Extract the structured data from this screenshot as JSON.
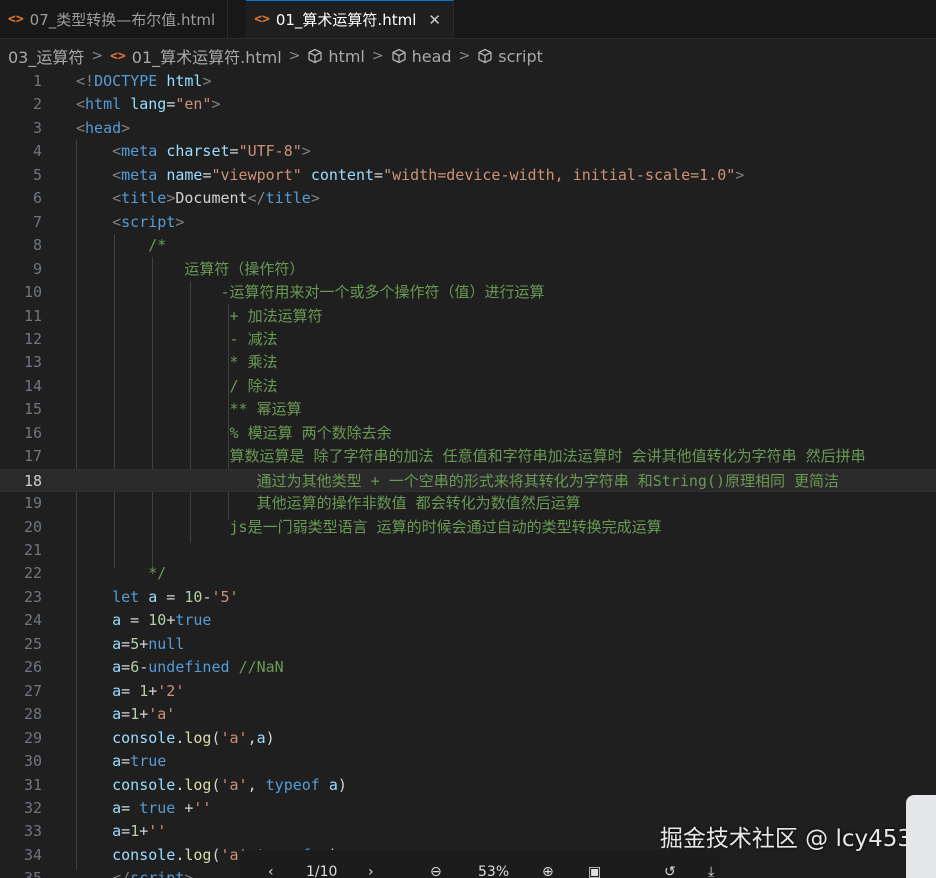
{
  "tabs": [
    {
      "icon": "html-file-icon",
      "glyph": "<>",
      "label": "07_类型转换—布尔值.html",
      "active": false
    },
    {
      "icon": "html-file-icon",
      "glyph": "<>",
      "label": "01_算术运算符.html",
      "active": true,
      "close": "✕"
    }
  ],
  "breadcrumb": {
    "separator": ">",
    "items": [
      "03_运算符",
      "01_算术运算符.html",
      "html",
      "head",
      "script"
    ]
  },
  "editor": {
    "current_line": 18,
    "lines": [
      {
        "n": "1",
        "tokens": [
          [
            "t-punct",
            "<!"
          ],
          [
            "t-html-kw",
            "DOCTYPE "
          ],
          [
            "t-attr",
            "html"
          ],
          [
            "t-punct",
            ">"
          ]
        ]
      },
      {
        "n": "2",
        "tokens": [
          [
            "t-punct",
            "<"
          ],
          [
            "t-tag",
            "html "
          ],
          [
            "t-attr",
            "lang"
          ],
          [
            "t-text",
            "="
          ],
          [
            "t-str",
            "\"en\""
          ],
          [
            "t-punct",
            ">"
          ]
        ]
      },
      {
        "n": "3",
        "tokens": [
          [
            "t-punct",
            "<"
          ],
          [
            "t-tag",
            "head"
          ],
          [
            "t-punct",
            ">"
          ]
        ]
      },
      {
        "n": "4",
        "tokens": [
          [
            "t-text",
            "    "
          ],
          [
            "t-punct",
            "<"
          ],
          [
            "t-tag",
            "meta "
          ],
          [
            "t-attr",
            "charset"
          ],
          [
            "t-text",
            "="
          ],
          [
            "t-str",
            "\"UTF-8\""
          ],
          [
            "t-punct",
            ">"
          ]
        ]
      },
      {
        "n": "5",
        "tokens": [
          [
            "t-text",
            "    "
          ],
          [
            "t-punct",
            "<"
          ],
          [
            "t-tag",
            "meta "
          ],
          [
            "t-attr",
            "name"
          ],
          [
            "t-text",
            "="
          ],
          [
            "t-str",
            "\"viewport\" "
          ],
          [
            "t-attr",
            "content"
          ],
          [
            "t-text",
            "="
          ],
          [
            "t-str",
            "\"width=device-width, initial-scale=1.0\""
          ],
          [
            "t-punct",
            ">"
          ]
        ]
      },
      {
        "n": "6",
        "tokens": [
          [
            "t-text",
            "    "
          ],
          [
            "t-punct",
            "<"
          ],
          [
            "t-tag",
            "title"
          ],
          [
            "t-punct",
            ">"
          ],
          [
            "t-text",
            "Document"
          ],
          [
            "t-punct",
            "</"
          ],
          [
            "t-tag",
            "title"
          ],
          [
            "t-punct",
            ">"
          ]
        ]
      },
      {
        "n": "7",
        "tokens": [
          [
            "t-text",
            "    "
          ],
          [
            "t-punct",
            "<"
          ],
          [
            "t-tag",
            "script"
          ],
          [
            "t-punct",
            ">"
          ]
        ]
      },
      {
        "n": "8",
        "tokens": [
          [
            "t-cmt",
            "        /*"
          ]
        ]
      },
      {
        "n": "9",
        "tokens": [
          [
            "t-cmt",
            "            运算符（操作符）"
          ]
        ]
      },
      {
        "n": "10",
        "tokens": [
          [
            "t-cmt",
            "                -运算符用来对一个或多个操作符（值）进行运算"
          ]
        ]
      },
      {
        "n": "11",
        "tokens": [
          [
            "t-cmt",
            "                 + 加法运算符"
          ]
        ]
      },
      {
        "n": "12",
        "tokens": [
          [
            "t-cmt",
            "                 - 减法"
          ]
        ]
      },
      {
        "n": "13",
        "tokens": [
          [
            "t-cmt",
            "                 * 乘法"
          ]
        ]
      },
      {
        "n": "14",
        "tokens": [
          [
            "t-cmt",
            "                 / 除法"
          ]
        ]
      },
      {
        "n": "15",
        "tokens": [
          [
            "t-cmt",
            "                 ** 幂运算"
          ]
        ]
      },
      {
        "n": "16",
        "tokens": [
          [
            "t-cmt",
            "                 % 模运算 两个数除去余"
          ]
        ]
      },
      {
        "n": "17",
        "tokens": [
          [
            "t-cmt",
            "                 算数运算是 除了字符串的加法 任意值和字符串加法运算时 会讲其他值转化为字符串 然后拼串"
          ]
        ]
      },
      {
        "n": "18",
        "tokens": [
          [
            "t-cmt",
            "                    通过为其他类型 + 一个空串的形式来将其转化为字符串 和String()原理相同 更简洁"
          ]
        ]
      },
      {
        "n": "19",
        "tokens": [
          [
            "t-cmt",
            "                    其他运算的操作非数值 都会转化为数值然后运算"
          ]
        ]
      },
      {
        "n": "20",
        "tokens": [
          [
            "t-cmt",
            "                 js是一门弱类型语言 运算的时候会通过自动的类型转换完成运算"
          ]
        ]
      },
      {
        "n": "21",
        "tokens": []
      },
      {
        "n": "22",
        "tokens": [
          [
            "t-cmt",
            "        */"
          ]
        ]
      },
      {
        "n": "23",
        "tokens": [
          [
            "t-text",
            "    "
          ],
          [
            "t-kw",
            "let "
          ],
          [
            "t-attr",
            "a"
          ],
          [
            "t-text",
            " = "
          ],
          [
            "t-num",
            "10"
          ],
          [
            "t-text",
            "-"
          ],
          [
            "t-str",
            "'5'"
          ]
        ]
      },
      {
        "n": "24",
        "tokens": [
          [
            "t-text",
            "    "
          ],
          [
            "t-attr",
            "a"
          ],
          [
            "t-text",
            " = "
          ],
          [
            "t-num",
            "10"
          ],
          [
            "t-text",
            "+"
          ],
          [
            "t-kw",
            "true"
          ]
        ]
      },
      {
        "n": "25",
        "tokens": [
          [
            "t-text",
            "    "
          ],
          [
            "t-attr",
            "a"
          ],
          [
            "t-text",
            "="
          ],
          [
            "t-num",
            "5"
          ],
          [
            "t-text",
            "+"
          ],
          [
            "t-kw",
            "null"
          ]
        ]
      },
      {
        "n": "26",
        "tokens": [
          [
            "t-text",
            "    "
          ],
          [
            "t-attr",
            "a"
          ],
          [
            "t-text",
            "="
          ],
          [
            "t-num",
            "6"
          ],
          [
            "t-text",
            "-"
          ],
          [
            "t-kw",
            "undefined "
          ],
          [
            "t-cmt",
            "//NaN"
          ]
        ]
      },
      {
        "n": "27",
        "tokens": [
          [
            "t-text",
            "    "
          ],
          [
            "t-attr",
            "a"
          ],
          [
            "t-text",
            "= "
          ],
          [
            "t-num",
            "1"
          ],
          [
            "t-text",
            "+"
          ],
          [
            "t-str",
            "'2'"
          ]
        ]
      },
      {
        "n": "28",
        "tokens": [
          [
            "t-text",
            "    "
          ],
          [
            "t-attr",
            "a"
          ],
          [
            "t-text",
            "="
          ],
          [
            "t-num",
            "1"
          ],
          [
            "t-text",
            "+"
          ],
          [
            "t-str",
            "'a'"
          ]
        ]
      },
      {
        "n": "29",
        "tokens": [
          [
            "t-text",
            "    "
          ],
          [
            "t-attr",
            "console"
          ],
          [
            "t-text",
            "."
          ],
          [
            "t-fn",
            "log"
          ],
          [
            "t-text",
            "("
          ],
          [
            "t-str",
            "'a'"
          ],
          [
            "t-text",
            ","
          ],
          [
            "t-attr",
            "a"
          ],
          [
            "t-text",
            ")"
          ]
        ]
      },
      {
        "n": "30",
        "tokens": [
          [
            "t-text",
            "    "
          ],
          [
            "t-attr",
            "a"
          ],
          [
            "t-text",
            "="
          ],
          [
            "t-kw",
            "true"
          ]
        ]
      },
      {
        "n": "31",
        "tokens": [
          [
            "t-text",
            "    "
          ],
          [
            "t-attr",
            "console"
          ],
          [
            "t-text",
            "."
          ],
          [
            "t-fn",
            "log"
          ],
          [
            "t-text",
            "("
          ],
          [
            "t-str",
            "'a'"
          ],
          [
            "t-text",
            ", "
          ],
          [
            "t-kw",
            "typeof "
          ],
          [
            "t-attr",
            "a"
          ],
          [
            "t-text",
            ")"
          ]
        ]
      },
      {
        "n": "32",
        "tokens": [
          [
            "t-text",
            "    "
          ],
          [
            "t-attr",
            "a"
          ],
          [
            "t-text",
            "= "
          ],
          [
            "t-kw",
            "true "
          ],
          [
            "t-text",
            "+"
          ],
          [
            "t-str",
            "''"
          ]
        ]
      },
      {
        "n": "33",
        "tokens": [
          [
            "t-text",
            "    "
          ],
          [
            "t-attr",
            "a"
          ],
          [
            "t-text",
            "="
          ],
          [
            "t-num",
            "1"
          ],
          [
            "t-text",
            "+"
          ],
          [
            "t-str",
            "''"
          ]
        ]
      },
      {
        "n": "34",
        "tokens": [
          [
            "t-text",
            "    "
          ],
          [
            "t-attr",
            "console"
          ],
          [
            "t-text",
            "."
          ],
          [
            "t-fn",
            "log"
          ],
          [
            "t-text",
            "("
          ],
          [
            "t-str",
            "'a'"
          ],
          [
            "t-text",
            ","
          ],
          [
            "t-kw",
            "typeof "
          ],
          [
            "t-attr",
            "a"
          ],
          [
            "t-text",
            ")"
          ]
        ]
      },
      {
        "n": "35",
        "tokens": [
          [
            "t-text",
            "    "
          ],
          [
            "t-punct",
            "</"
          ],
          [
            "t-tag",
            "script"
          ],
          [
            "t-punct",
            ">"
          ]
        ]
      }
    ]
  },
  "watermark": "掘金技术社区 @ lcy453",
  "pdf_toolbar": {
    "page": "1/10",
    "zoom": "53%",
    "icons": [
      "chevron-left-icon",
      "chevron-right-icon",
      "zoom-out-icon",
      "zoom-in-icon",
      "fit-page-icon",
      "rotate-icon",
      "download-icon"
    ]
  }
}
